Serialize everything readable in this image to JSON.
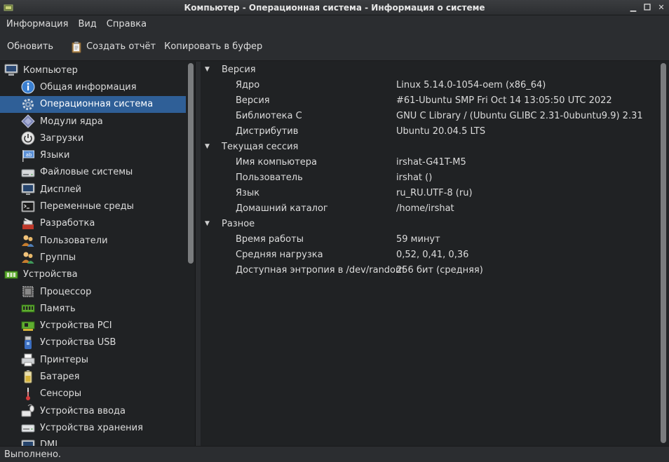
{
  "window": {
    "title": "Компьютер - Операционная система - Информация о системе"
  },
  "menu": [
    "Информация",
    "Вид",
    "Справка"
  ],
  "toolbar": {
    "refresh_label": "Обновить",
    "report_label": "Создать отчёт",
    "copy_label": "Копировать в буфер"
  },
  "sidebar": {
    "computer": {
      "label": "Компьютер",
      "items": [
        {
          "label": "Общая информация",
          "icon": "info-icon"
        },
        {
          "label": "Операционная система",
          "icon": "gear-icon",
          "selected": true
        },
        {
          "label": "Модули ядра",
          "icon": "module-icon"
        },
        {
          "label": "Загрузки",
          "icon": "power-icon"
        },
        {
          "label": "Языки",
          "icon": "language-flag-icon"
        },
        {
          "label": "Файловые системы",
          "icon": "drive-icon"
        },
        {
          "label": "Дисплей",
          "icon": "monitor-icon"
        },
        {
          "label": "Переменные среды",
          "icon": "terminal-icon"
        },
        {
          "label": "Разработка",
          "icon": "development-icon"
        },
        {
          "label": "Пользователи",
          "icon": "users-icon"
        },
        {
          "label": "Группы",
          "icon": "groups-icon"
        }
      ]
    },
    "devices": {
      "label": "Устройства",
      "items": [
        {
          "label": "Процессор",
          "icon": "cpu-icon"
        },
        {
          "label": "Память",
          "icon": "memory-icon"
        },
        {
          "label": "Устройства PCI",
          "icon": "pci-card-icon"
        },
        {
          "label": "Устройства USB",
          "icon": "usb-icon"
        },
        {
          "label": "Принтеры",
          "icon": "printer-icon"
        },
        {
          "label": "Батарея",
          "icon": "battery-icon"
        },
        {
          "label": "Сенсоры",
          "icon": "thermometer-icon"
        },
        {
          "label": "Устройства ввода",
          "icon": "input-device-icon"
        },
        {
          "label": "Устройства хранения",
          "icon": "storage-icon"
        },
        {
          "label": "DMI",
          "icon": "dmi-icon"
        }
      ]
    }
  },
  "details": {
    "sections": [
      {
        "title": "Версия",
        "rows": [
          {
            "key": "Ядро",
            "value": "Linux 5.14.0-1054-oem (x86_64)"
          },
          {
            "key": "Версия",
            "value": "#61-Ubuntu SMP Fri Oct 14 13:05:50 UTC 2022"
          },
          {
            "key": "Библиотека C",
            "value": "GNU C Library / (Ubuntu GLIBC 2.31-0ubuntu9.9) 2.31"
          },
          {
            "key": "Дистрибутив",
            "value": "Ubuntu 20.04.5 LTS"
          }
        ]
      },
      {
        "title": "Текущая сессия",
        "rows": [
          {
            "key": "Имя компьютера",
            "value": "irshat-G41T-M5"
          },
          {
            "key": "Пользователь",
            "value": "irshat ()"
          },
          {
            "key": "Язык",
            "value": "ru_RU.UTF-8 (ru)"
          },
          {
            "key": "Домашний каталог",
            "value": "/home/irshat"
          }
        ]
      },
      {
        "title": "Разное",
        "rows": [
          {
            "key": "Время работы",
            "value": "59 минут"
          },
          {
            "key": "Средняя нагрузка",
            "value": "0,52, 0,41, 0,36"
          },
          {
            "key": "Доступная энтропия в /dev/random",
            "value": "256 бит (средняя)"
          }
        ]
      }
    ]
  },
  "status": {
    "text": "Выполнено."
  },
  "colors": {
    "selection": "#2f5f97",
    "background": "#202224",
    "chrome": "#2b2d30"
  }
}
